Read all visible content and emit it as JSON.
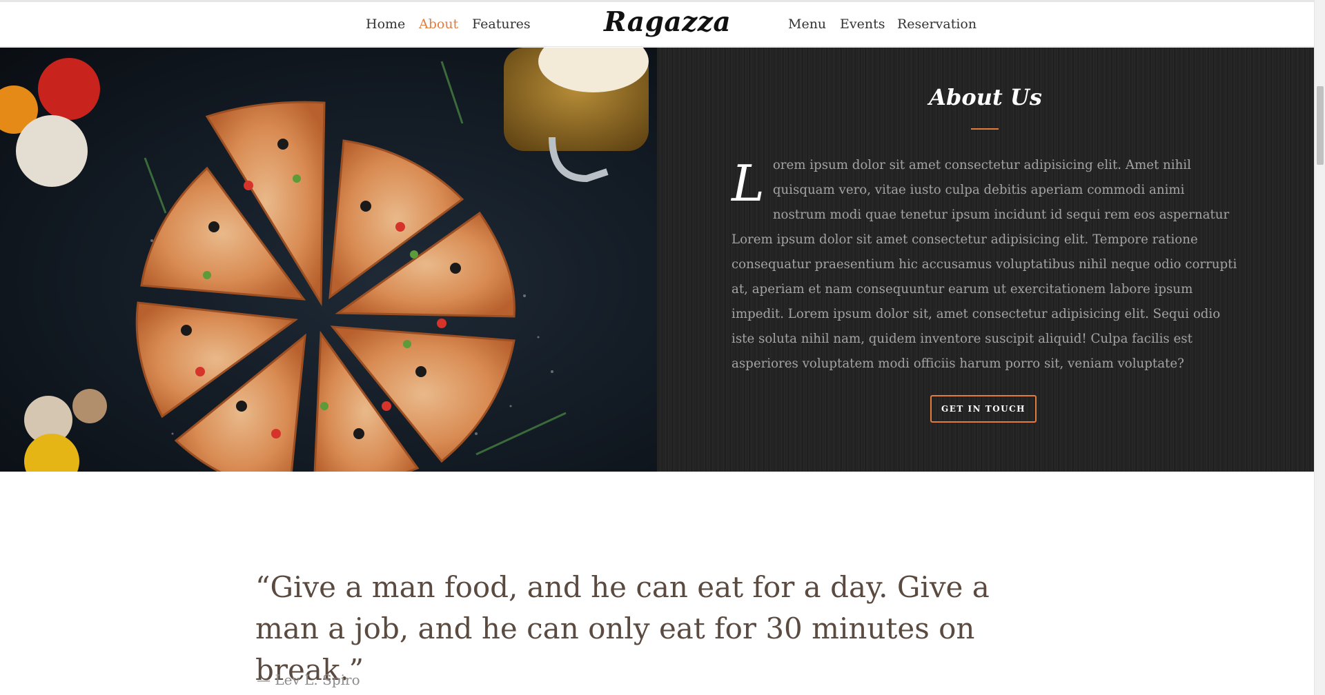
{
  "nav": {
    "left": [
      {
        "label": "Home",
        "active": false
      },
      {
        "label": "About",
        "active": true
      },
      {
        "label": "Features",
        "active": false
      }
    ],
    "logo": "Ragazza",
    "right": [
      {
        "label": "Menu",
        "active": false
      },
      {
        "label": "Events",
        "active": false
      },
      {
        "label": "Reservation",
        "active": false
      }
    ]
  },
  "about": {
    "title": "About Us",
    "dropcap": "L",
    "body": "orem ipsum dolor sit amet consectetur adipisicing elit. Amet nihil quisquam vero, vitae iusto culpa debitis aperiam commodi animi nostrum modi quae tenetur ipsum incidunt id sequi rem eos aspernatur Lorem ipsum dolor sit amet consectetur adipisicing elit. Tempore ratione consequatur praesentium hic accusamus voluptatibus nihil neque odio corrupti at, aperiam et nam consequuntur earum ut exercitationem labore ipsum impedit. Lorem ipsum dolor sit, amet consectetur adipisicing elit. Sequi odio iste soluta nihil nam, quidem inventore suscipit aliquid! Culpa facilis est asperiores voluptatem modi officiis harum porro sit, veniam voluptate?",
    "button_label": "GET IN TOUCH",
    "image_icon": "pizza-photo"
  },
  "quote": {
    "text": "“Give a man food, and he can eat for a day. Give a man a job, and he can only eat for 30 minutes on break.”",
    "author": "— Lev L. Spiro"
  },
  "colors": {
    "accent": "#e27d3f",
    "panel_bg": "#242424",
    "quote_text": "#5a4a40"
  }
}
